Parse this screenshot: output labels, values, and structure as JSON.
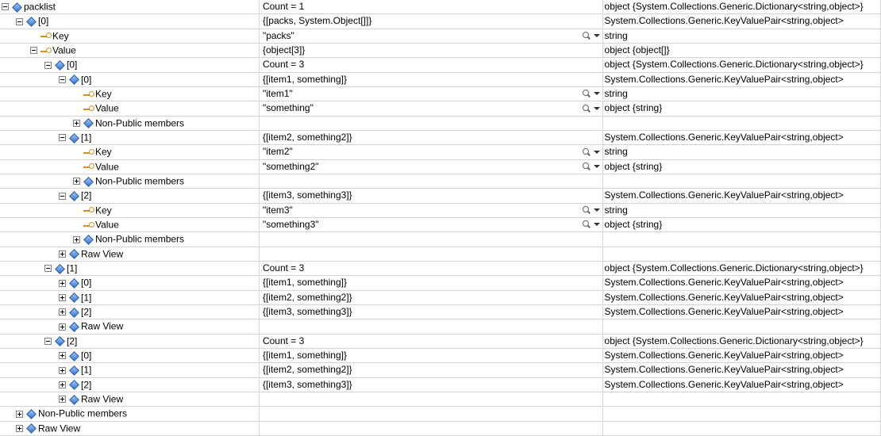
{
  "types": {
    "dictObj": "object {System.Collections.Generic.Dictionary<string,object>}",
    "kvp": "System.Collections.Generic.KeyValuePair<string,object>",
    "string": "string",
    "objArr": "object {object[]}",
    "objString": "object {string}"
  },
  "labels": {
    "key": "Key",
    "value": "Value",
    "nonPublic": "Non-Public members",
    "rawView": "Raw View"
  },
  "rows": [
    {
      "id": "r0",
      "indent": 0,
      "exp": "expanded",
      "icon": "diamond",
      "name": "packlist",
      "value": "Count = 1",
      "type": "dictObj"
    },
    {
      "id": "r1",
      "indent": 1,
      "exp": "expanded",
      "icon": "diamond",
      "name": "[0]",
      "value": "{[packs, System.Object[]]}",
      "type": "kvp"
    },
    {
      "id": "r2",
      "indent": 2,
      "exp": "none",
      "icon": "key",
      "nameRef": "key",
      "value": "\"packs\"",
      "type": "string",
      "mag": true
    },
    {
      "id": "r3",
      "indent": 2,
      "exp": "expanded",
      "icon": "key",
      "nameRef": "value",
      "value": "{object[3]}",
      "type": "objArr"
    },
    {
      "id": "r4",
      "indent": 3,
      "exp": "expanded",
      "icon": "diamond",
      "name": "[0]",
      "value": "Count = 3",
      "type": "dictObj"
    },
    {
      "id": "r5",
      "indent": 4,
      "exp": "expanded",
      "icon": "diamond",
      "name": "[0]",
      "value": "{[item1, something]}",
      "type": "kvp"
    },
    {
      "id": "r6",
      "indent": 5,
      "exp": "none",
      "icon": "key",
      "nameRef": "key",
      "value": "\"item1\"",
      "type": "string",
      "mag": true
    },
    {
      "id": "r7",
      "indent": 5,
      "exp": "none",
      "icon": "key",
      "nameRef": "value",
      "value": "\"something\"",
      "type": "objString",
      "mag": true
    },
    {
      "id": "r8",
      "indent": 5,
      "exp": "collapsed",
      "icon": "diamond",
      "nameRef": "nonPublic",
      "value": "",
      "type": ""
    },
    {
      "id": "r9",
      "indent": 4,
      "exp": "expanded",
      "icon": "diamond",
      "name": "[1]",
      "value": "{[item2, something2]}",
      "type": "kvp"
    },
    {
      "id": "r10",
      "indent": 5,
      "exp": "none",
      "icon": "key",
      "nameRef": "key",
      "value": "\"item2\"",
      "type": "string",
      "mag": true
    },
    {
      "id": "r11",
      "indent": 5,
      "exp": "none",
      "icon": "key",
      "nameRef": "value",
      "value": "\"something2\"",
      "type": "objString",
      "mag": true
    },
    {
      "id": "r12",
      "indent": 5,
      "exp": "collapsed",
      "icon": "diamond",
      "nameRef": "nonPublic",
      "value": "",
      "type": ""
    },
    {
      "id": "r13",
      "indent": 4,
      "exp": "expanded",
      "icon": "diamond",
      "name": "[2]",
      "value": "{[item3, something3]}",
      "type": "kvp"
    },
    {
      "id": "r14",
      "indent": 5,
      "exp": "none",
      "icon": "key",
      "nameRef": "key",
      "value": "\"item3\"",
      "type": "string",
      "mag": true
    },
    {
      "id": "r15",
      "indent": 5,
      "exp": "none",
      "icon": "key",
      "nameRef": "value",
      "value": "\"something3\"",
      "type": "objString",
      "mag": true
    },
    {
      "id": "r16",
      "indent": 5,
      "exp": "collapsed",
      "icon": "diamond",
      "nameRef": "nonPublic",
      "value": "",
      "type": ""
    },
    {
      "id": "r17",
      "indent": 4,
      "exp": "collapsed",
      "icon": "diamond",
      "nameRef": "rawView",
      "value": "",
      "type": ""
    },
    {
      "id": "r18",
      "indent": 3,
      "exp": "expanded",
      "icon": "diamond",
      "name": "[1]",
      "value": "Count = 3",
      "type": "dictObj"
    },
    {
      "id": "r19",
      "indent": 4,
      "exp": "collapsed",
      "icon": "diamond",
      "name": "[0]",
      "value": "{[item1, something]}",
      "type": "kvp"
    },
    {
      "id": "r20",
      "indent": 4,
      "exp": "collapsed",
      "icon": "diamond",
      "name": "[1]",
      "value": "{[item2, something2]}",
      "type": "kvp"
    },
    {
      "id": "r21",
      "indent": 4,
      "exp": "collapsed",
      "icon": "diamond",
      "name": "[2]",
      "value": "{[item3, something3]}",
      "type": "kvp"
    },
    {
      "id": "r22",
      "indent": 4,
      "exp": "collapsed",
      "icon": "diamond",
      "nameRef": "rawView",
      "value": "",
      "type": ""
    },
    {
      "id": "r23",
      "indent": 3,
      "exp": "expanded",
      "icon": "diamond",
      "name": "[2]",
      "value": "Count = 3",
      "type": "dictObj"
    },
    {
      "id": "r24",
      "indent": 4,
      "exp": "collapsed",
      "icon": "diamond",
      "name": "[0]",
      "value": "{[item1, something]}",
      "type": "kvp"
    },
    {
      "id": "r25",
      "indent": 4,
      "exp": "collapsed",
      "icon": "diamond",
      "name": "[1]",
      "value": "{[item2, something2]}",
      "type": "kvp"
    },
    {
      "id": "r26",
      "indent": 4,
      "exp": "collapsed",
      "icon": "diamond",
      "name": "[2]",
      "value": "{[item3, something3]}",
      "type": "kvp"
    },
    {
      "id": "r27",
      "indent": 4,
      "exp": "collapsed",
      "icon": "diamond",
      "nameRef": "rawView",
      "value": "",
      "type": ""
    },
    {
      "id": "r28",
      "indent": 1,
      "exp": "collapsed",
      "icon": "diamond",
      "nameRef": "nonPublic",
      "value": "",
      "type": ""
    },
    {
      "id": "r29",
      "indent": 1,
      "exp": "collapsed",
      "icon": "diamond",
      "nameRef": "rawView",
      "value": "",
      "type": ""
    }
  ]
}
